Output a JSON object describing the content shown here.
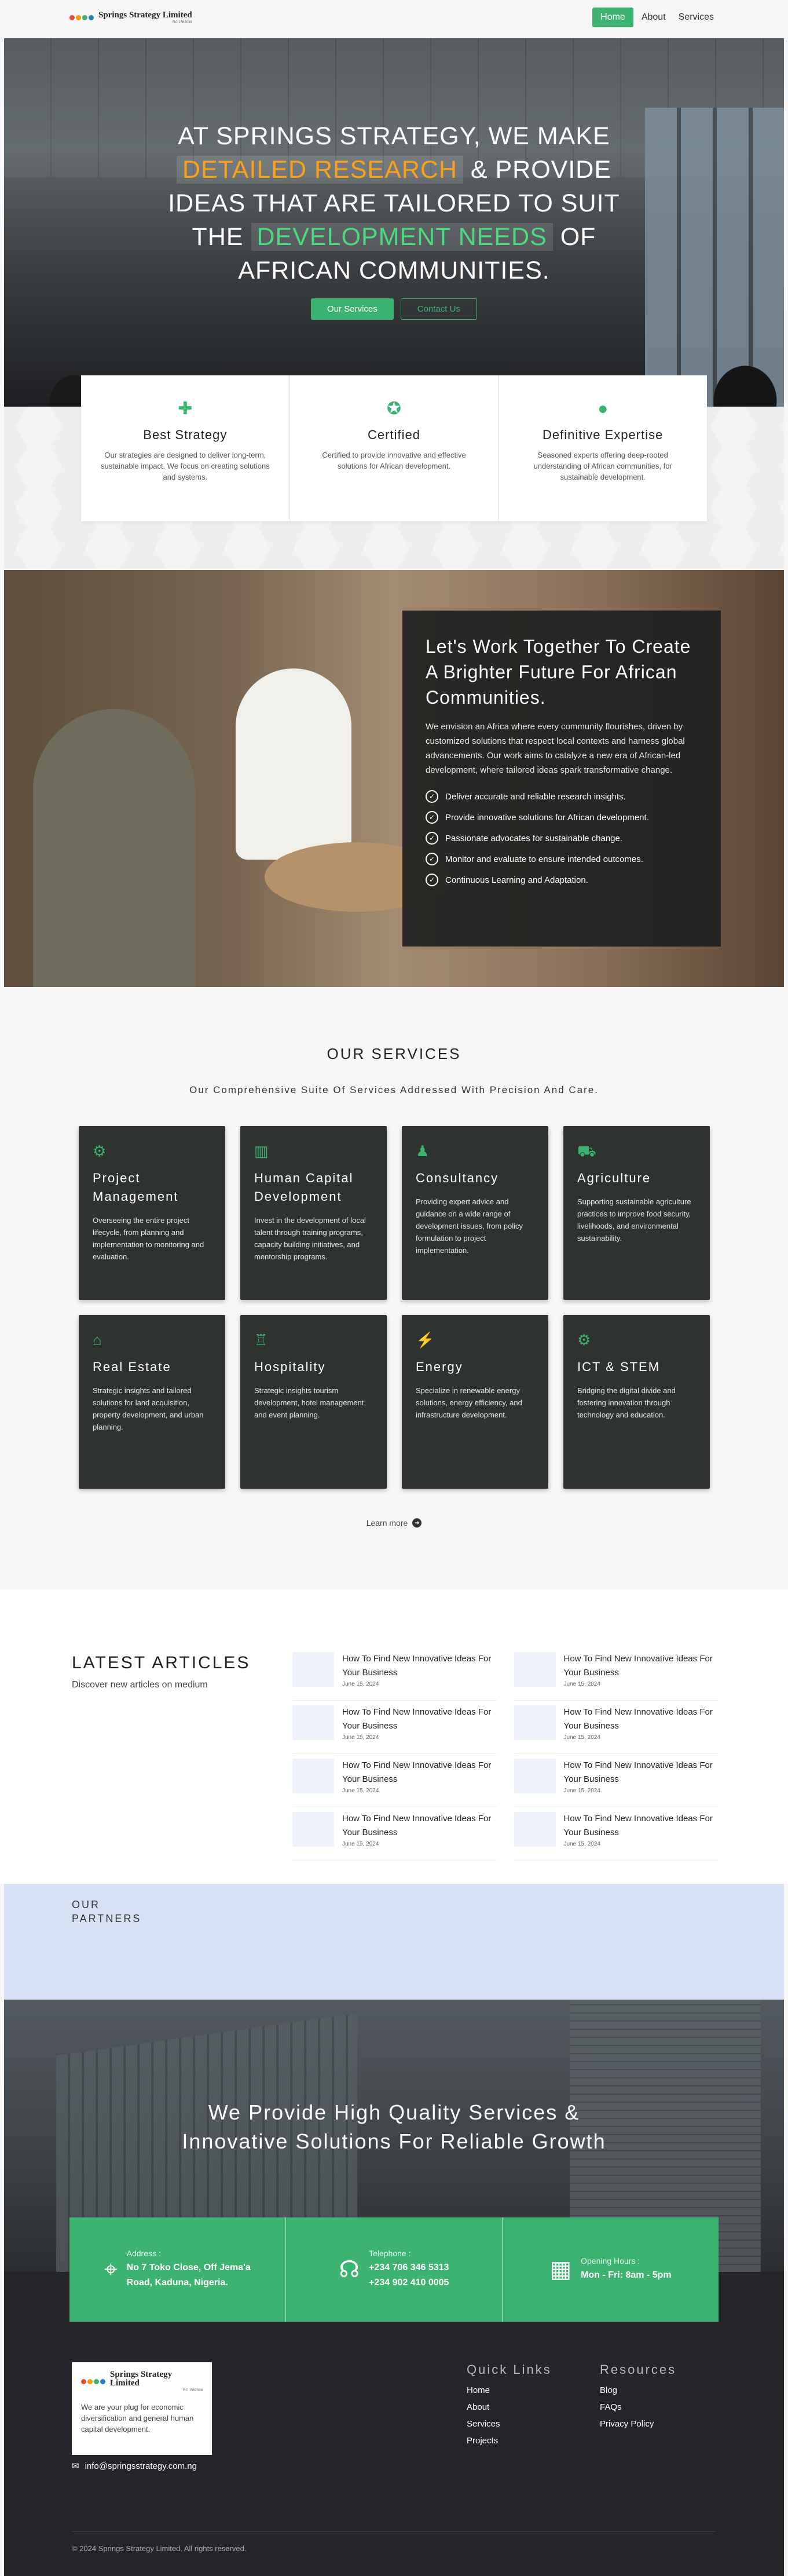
{
  "brand": {
    "name": "Springs Strategy Limited",
    "tagline": "RC 1562038",
    "dot_colors": [
      "#e74c3c",
      "#f39c12",
      "#3cb371",
      "#2980b9"
    ]
  },
  "nav": {
    "items": [
      "Home",
      "About",
      "Services"
    ],
    "active": "Home"
  },
  "hero": {
    "line1": "AT SPRINGS STRATEGY, WE MAKE",
    "highlight1": "DETAILED RESEARCH",
    "line2_rest": "& PROVIDE",
    "line3": "IDEAS THAT ARE TAILORED TO SUIT",
    "line4_pre": "THE",
    "highlight2": "DEVELOPMENT NEEDS",
    "line4_post": "OF",
    "line5": "AFRICAN COMMUNITIES.",
    "btn_primary": "Our Services",
    "btn_secondary": "Contact Us"
  },
  "features": [
    {
      "icon": "puzzle-icon",
      "title": "Best Strategy",
      "text": "Our strategies are designed to deliver long-term, sustainable impact. We focus on creating solutions and systems."
    },
    {
      "icon": "award-icon",
      "title": "Certified",
      "text": "Certified to provide innovative and effective solutions for African development."
    },
    {
      "icon": "globe-icon",
      "title": "Definitive Expertise",
      "text": "Seasoned experts offering deep-rooted understanding of African communities, for sustainable development."
    }
  ],
  "collab": {
    "heading": "Let's Work Together To Create A Brighter Future For African Communities.",
    "body": "We envision an Africa where every community flourishes, driven by customized solutions that respect local contexts and harness global advancements. Our work aims to catalyze a new era of African-led development, where tailored ideas spark transformative change.",
    "checks": [
      "Deliver accurate and reliable research insights.",
      "Provide innovative solutions for African development.",
      "Passionate advocates for sustainable change.",
      "Monitor and evaluate to ensure intended outcomes.",
      "Continuous Learning and Adaptation."
    ]
  },
  "services": {
    "title": "OUR SERVICES",
    "subtitle": "Our Comprehensive Suite Of Services Addressed With Precision And Care.",
    "items": [
      {
        "icon": "project-icon",
        "title": "Project Management",
        "text": "Overseeing the entire project lifecycle, from planning and implementation to monitoring and evaluation."
      },
      {
        "icon": "chart-icon",
        "title": "Human Capital Development",
        "text": "Invest in the development of local talent through training programs, capacity building initiatives, and mentorship programs."
      },
      {
        "icon": "consultant-icon",
        "title": "Consultancy",
        "text": "Providing expert advice and guidance on a wide range of development issues, from policy formulation to project implementation."
      },
      {
        "icon": "tractor-icon",
        "title": "Agriculture",
        "text": "Supporting sustainable agriculture practices to improve food security, livelihoods, and environmental sustainability."
      },
      {
        "icon": "house-icon",
        "title": "Real Estate",
        "text": "Strategic insights and tailored solutions for land acquisition, property development, and urban planning."
      },
      {
        "icon": "hospitality-icon",
        "title": "Hospitality",
        "text": "Strategic insights tourism development, hotel management, and event planning."
      },
      {
        "icon": "bolt-icon",
        "title": "Energy",
        "text": "Specialize in renewable energy solutions, energy efficiency, and infrastructure development."
      },
      {
        "icon": "gear-icon",
        "title": "ICT & STEM",
        "text": "Bridging the digital divide and fostering innovation through technology and education."
      }
    ],
    "learn_more": "Learn more"
  },
  "articles": {
    "title": "LATEST ARTICLES",
    "subtitle": "Discover new articles on medium",
    "items": [
      {
        "title": "How To Find New Innovative Ideas For Your Business",
        "date": "June 15, 2024"
      },
      {
        "title": "How To Find New Innovative Ideas For Your Business",
        "date": "June 15, 2024"
      },
      {
        "title": "How To Find New Innovative Ideas For Your Business",
        "date": "June 15, 2024"
      },
      {
        "title": "How To Find New Innovative Ideas For Your Business",
        "date": "June 15, 2024"
      },
      {
        "title": "How To Find New Innovative Ideas For Your Business",
        "date": "June 15, 2024"
      },
      {
        "title": "How To Find New Innovative Ideas For Your Business",
        "date": "June 15, 2024"
      },
      {
        "title": "How To Find New Innovative Ideas For Your Business",
        "date": "June 15, 2024"
      },
      {
        "title": "How To Find New Innovative Ideas For Your Business",
        "date": "June 15, 2024"
      }
    ]
  },
  "partners": {
    "line1": "OUR",
    "line2": "PARTNERS"
  },
  "quality": {
    "line1": "We Provide High Quality Services &",
    "line2": "Innovative Solutions For Reliable Growth"
  },
  "contact": [
    {
      "icon": "location-icon",
      "label": "Address :",
      "lines": [
        "No 7 Toko Close, Off Jema'a",
        "Road, Kaduna, Nigeria."
      ]
    },
    {
      "icon": "headset-icon",
      "label": "Telephone :",
      "lines": [
        "+234 706 346 5313",
        "+234 902 410 0005"
      ]
    },
    {
      "icon": "building-icon",
      "label": "Opening Hours :",
      "lines": [
        "Mon - Fri: 8am - 5pm"
      ]
    }
  ],
  "footer": {
    "about": "We are your plug for economic diversification and general human capital development.",
    "email": "info@springsstrategy.com.ng",
    "quick_title": "Quick Links",
    "quick_links": [
      "Home",
      "About",
      "Services",
      "Projects"
    ],
    "res_title": "Resources",
    "res_links": [
      "Blog",
      "FAQs",
      "Privacy Policy"
    ],
    "copyright": "© 2024 Springs Strategy Limited. All rights reserved."
  },
  "colors": {
    "accent": "#3cb371",
    "highlight_orange": "#f7a21b",
    "dark_card": "#2f332f",
    "footer": "#232528"
  }
}
